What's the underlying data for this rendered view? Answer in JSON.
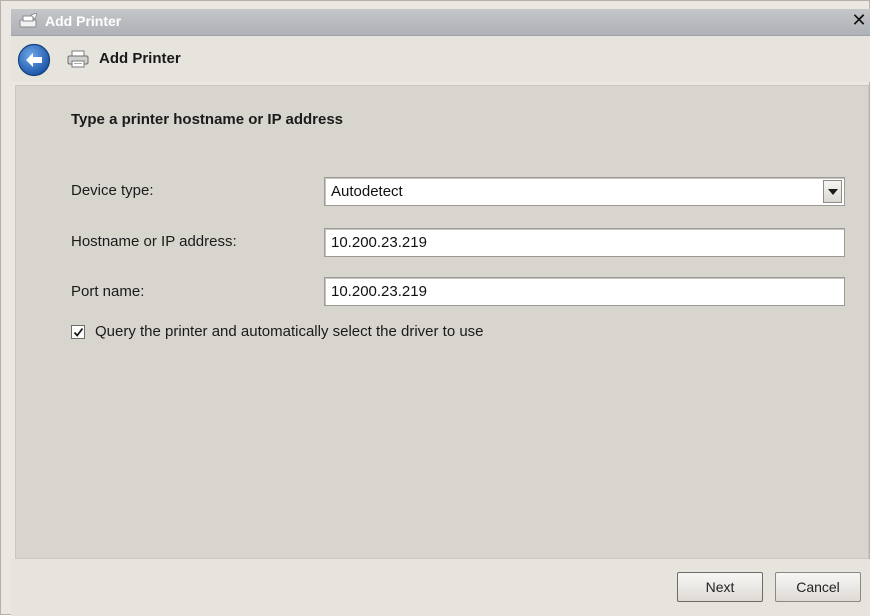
{
  "window": {
    "title": "Add Printer",
    "close_glyph": "✕"
  },
  "header": {
    "title": "Add Printer",
    "back_icon": "back-arrow-icon",
    "printer_icon": "printer-icon"
  },
  "form": {
    "heading": "Type a printer hostname or IP address",
    "device_type": {
      "label": "Device type:",
      "value": "Autodetect"
    },
    "hostname": {
      "label": "Hostname or IP address:",
      "value": "10.200.23.219"
    },
    "port": {
      "label": "Port name:",
      "value": "10.200.23.219"
    },
    "query_checkbox": {
      "checked": true,
      "label": "Query the printer and automatically select the driver to use"
    }
  },
  "footer": {
    "next_label": "Next",
    "cancel_label": "Cancel"
  },
  "colors": {
    "back_button_blue": "#2d6fc4",
    "window_bg": "#ebe8e3",
    "content_bg": "#d8d4ce"
  }
}
